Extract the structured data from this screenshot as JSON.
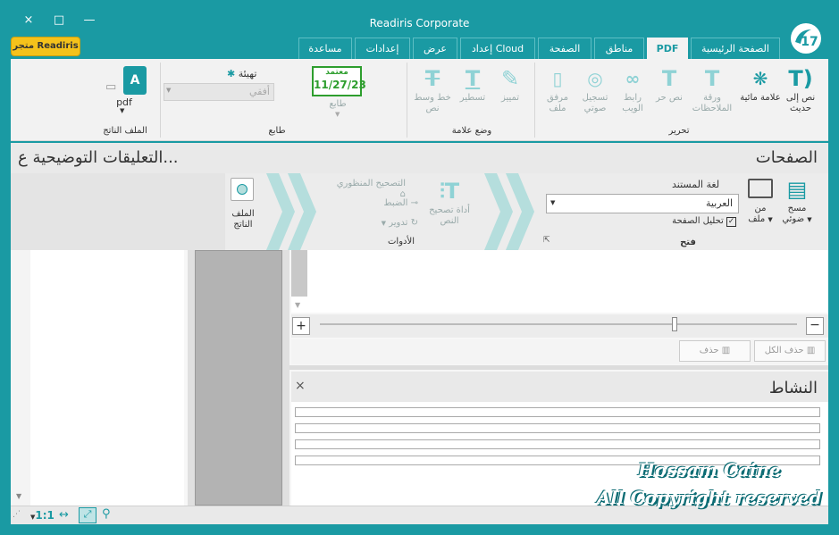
{
  "window": {
    "title": "Readiris Corporate",
    "close": "×",
    "maximize": "□",
    "minimize": "—"
  },
  "store_button": "متجر Readiris",
  "logo_text": "17",
  "tabs": [
    "الصفحة الرئيسية",
    "PDF",
    "مناطق",
    "الصفحة",
    "إعداد Cloud",
    "عرض",
    "إعدادات",
    "مساعدة"
  ],
  "ribbon": {
    "edit": {
      "label": "تحرير",
      "items": [
        "نص إلى حديث",
        "علامة مائية",
        "ورقة الملاحظات",
        "نص حر",
        "رابط الويب",
        "تسجيل صوتي",
        "مرفق ملف"
      ]
    },
    "annot": {
      "label": "وضع علامة",
      "items": [
        "تمييز",
        "تسطير",
        "خط وسط نص"
      ]
    },
    "stamp": {
      "label": "طابع",
      "stamp_top": "معتمد",
      "stamp_date": "11/27/23",
      "stamp_name": "طابع",
      "prep_label": "تهيئة",
      "orientation": "أفقي"
    },
    "output": {
      "label": "الملف الناتج",
      "format": "pdf"
    }
  },
  "pages_header": "الصفحات",
  "annotations_header": "التعليقات التوضيحية ع...",
  "workflow": {
    "scan": "مسح ضوئي",
    "from_file": "من ملف",
    "doc_lang_label": "لغة المستند",
    "doc_lang_value": "العربية",
    "analyze_page": "تحليل الصفحة",
    "open_label": "فتح",
    "text_correction": "أداة تصحيح النص",
    "perspective": "التصحيح المنظوري",
    "adjust": "الضبط",
    "rotate": "تدوير",
    "tools_label": "الأدوات",
    "output_file": "الملف الناتج"
  },
  "buttons": {
    "delete_all": "حذف الكل",
    "delete": "حذف"
  },
  "activity_header": "النشاط",
  "statusbar": {
    "zoom": "1:1"
  },
  "watermark": {
    "line1": "Hossam Caine",
    "line2": "All Copyright reserved"
  },
  "colors": {
    "accent": "#1a9aa3",
    "store": "#f5c21b",
    "stamp": "#2e9e2e"
  }
}
